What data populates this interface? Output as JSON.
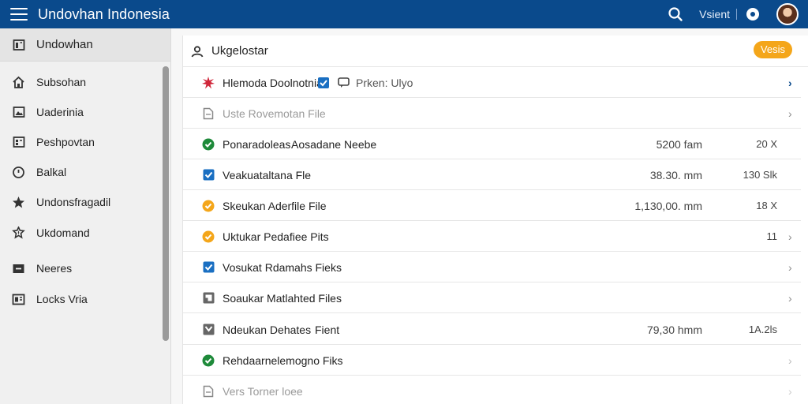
{
  "topbar": {
    "title": "Undovhan Indonesia",
    "link": "Vsient",
    "menu_icon": "hamburger-icon",
    "search_icon": "search-icon",
    "record_icon": "record-icon"
  },
  "sidebar": {
    "header": "Undowhan",
    "items": [
      {
        "label": "Subsohan",
        "icon": "home-icon"
      },
      {
        "label": "Uaderinia",
        "icon": "image-icon"
      },
      {
        "label": "Peshpovtan",
        "icon": "grid-icon"
      },
      {
        "label": "Balkal",
        "icon": "clock-icon"
      },
      {
        "label": "Undonsfragadil",
        "icon": "star-icon"
      },
      {
        "label": "Ukdomand",
        "icon": "badge-icon"
      },
      {
        "label": "Neeres",
        "icon": "minus-box-icon"
      },
      {
        "label": "Locks Vria",
        "icon": "window-icon"
      }
    ]
  },
  "panel": {
    "title": "Ukgelostar",
    "badge": "Vesis",
    "rows": [
      {
        "text_a": "Hlemoda Doolnotnia",
        "text_b": "Prken: Ulyo",
        "size": "",
        "count": "",
        "icon": "starburst-icon"
      },
      {
        "text_a": "Uste Rovemotan File",
        "text_b": "",
        "size": "",
        "count": "",
        "icon": "file-icon"
      },
      {
        "text_a": "Ponaradoleas",
        "text_b": "Aosadane Neebe",
        "size": "5200 fam",
        "count": "20 X",
        "icon": "check-circle-icon"
      },
      {
        "text_a": "Veakuataltana Fle",
        "text_b": "",
        "size": "38.30. mm",
        "count": "130 Slk",
        "icon": "checkbox-icon"
      },
      {
        "text_a": "Skeukan Aderfile File",
        "text_b": "",
        "size": "1,130,00. mm",
        "count": "18 X",
        "icon": "check-circle-icon"
      },
      {
        "text_a": "Uktukar Pedafiee Pits",
        "text_b": "",
        "size": "",
        "count": "11",
        "icon": "check-circle-icon"
      },
      {
        "text_a": "Vosukat Rdamahs Fieks",
        "text_b": "",
        "size": "",
        "count": "",
        "icon": "checkbox-icon"
      },
      {
        "text_a": "Soaukar Matlahted Files",
        "text_b": "",
        "size": "",
        "count": "",
        "icon": "folder-icon"
      },
      {
        "text_a": "Ndeukan Dehates",
        "text_b": "Fient",
        "size": "79,30 hmm",
        "count": "1A.2ls",
        "icon": "checkbox-icon"
      },
      {
        "text_a": "Rehdaarnelemogno Fiks",
        "text_b": "",
        "size": "",
        "count": "",
        "icon": "check-circle-icon"
      },
      {
        "text_a": "Vers Torner loee",
        "text_b": "",
        "size": "",
        "count": "",
        "icon": "file-icon"
      }
    ]
  },
  "colors": {
    "topbar": "#0a4a8c",
    "accent_blue": "#1a6fc2",
    "green": "#1e8a3a",
    "orange": "#f4a61a",
    "red": "#d0263a"
  }
}
